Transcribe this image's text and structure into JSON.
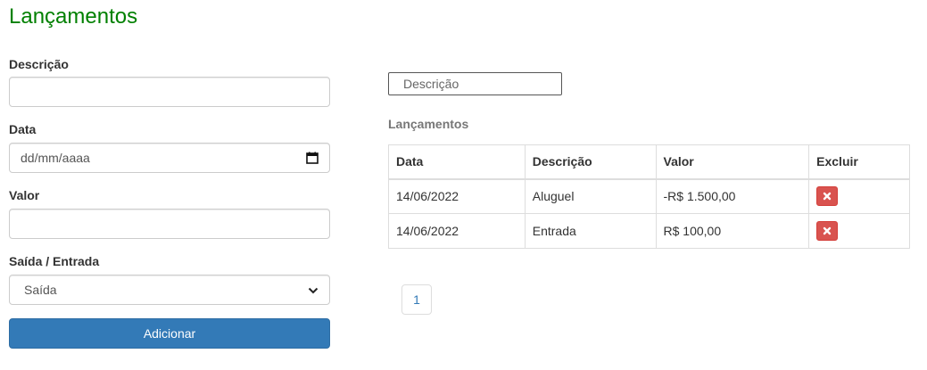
{
  "page": {
    "title": "Lançamentos"
  },
  "form": {
    "description": {
      "label": "Descrição",
      "value": ""
    },
    "date": {
      "label": "Data",
      "placeholder": "dd/mm/aaaa",
      "icon": "calendar-icon"
    },
    "value": {
      "label": "Valor",
      "value": ""
    },
    "type": {
      "label": "Saída / Entrada",
      "selected": "Saída",
      "icon": "chevron-down-icon"
    },
    "submit_label": "Adicionar"
  },
  "filter": {
    "placeholder": "Descrição"
  },
  "table": {
    "caption": "Lançamentos",
    "headers": [
      "Data",
      "Descrição",
      "Valor",
      "Excluir"
    ],
    "rows": [
      {
        "date": "14/06/2022",
        "description": "Aluguel",
        "value": "-R$ 1.500,00"
      },
      {
        "date": "14/06/2022",
        "description": "Entrada",
        "value": "R$ 100,00"
      }
    ]
  },
  "pagination": {
    "current": "1"
  },
  "colors": {
    "title": "#008000",
    "primary": "#337ab7",
    "danger": "#d9534f",
    "link": "#337ab7"
  }
}
